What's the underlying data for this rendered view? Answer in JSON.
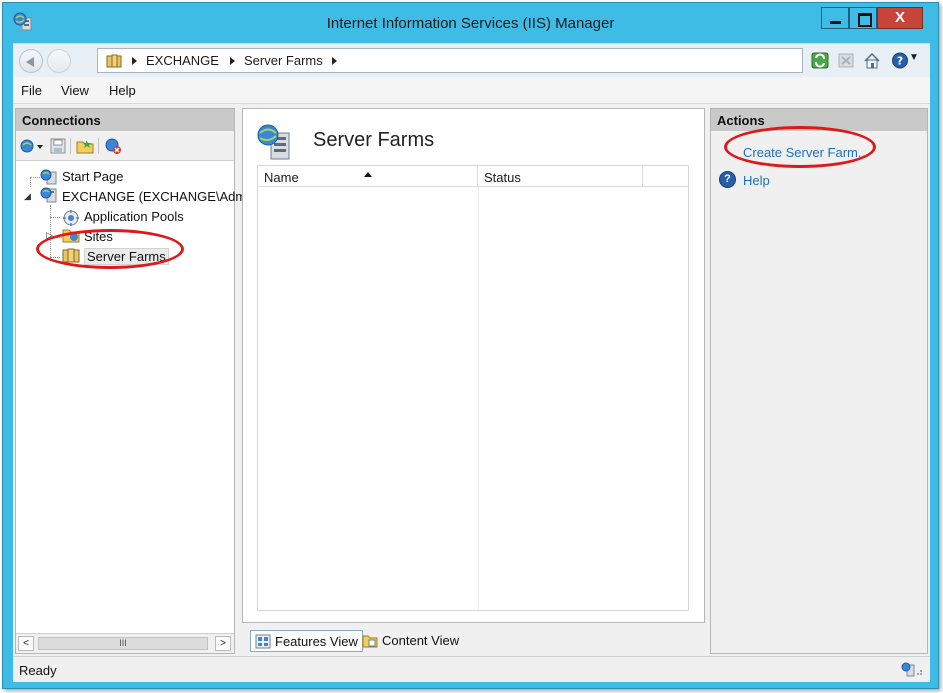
{
  "window": {
    "title": "Internet Information Services (IIS) Manager",
    "close_glyph": "X"
  },
  "address_bar": {
    "crumbs": [
      "EXCHANGE",
      "Server Farms"
    ]
  },
  "menu": {
    "items": [
      "File",
      "View",
      "Help"
    ]
  },
  "connections": {
    "header": "Connections",
    "tree": [
      {
        "label": "Start Page",
        "icon": "start-page-icon"
      },
      {
        "label": "EXCHANGE (EXCHANGE\\Adm",
        "icon": "server-icon",
        "expanded": true
      },
      {
        "label": "Application Pools",
        "icon": "app-pools-icon"
      },
      {
        "label": "Sites",
        "icon": "sites-folder-icon",
        "expanded": false
      },
      {
        "label": "Server Farms",
        "icon": "server-farms-icon",
        "selected": true
      }
    ],
    "scrollbar_thumb_glyph": "III",
    "scroll_left_glyph": "<",
    "scroll_right_glyph": ">"
  },
  "center": {
    "title": "Server Farms",
    "columns": [
      "Name",
      "Status"
    ],
    "rows": [],
    "view_tabs": [
      "Features View",
      "Content View"
    ],
    "active_tab": "Features View"
  },
  "actions": {
    "header": "Actions",
    "links": [
      "Create Server Farm...",
      "Help"
    ],
    "help_glyph": "?"
  },
  "status_bar": {
    "text": "Ready"
  },
  "colors": {
    "title_bar": "#3fbce6",
    "close_button": "#c7443a",
    "link": "#1f6fc1",
    "annotation": "#e01818"
  }
}
